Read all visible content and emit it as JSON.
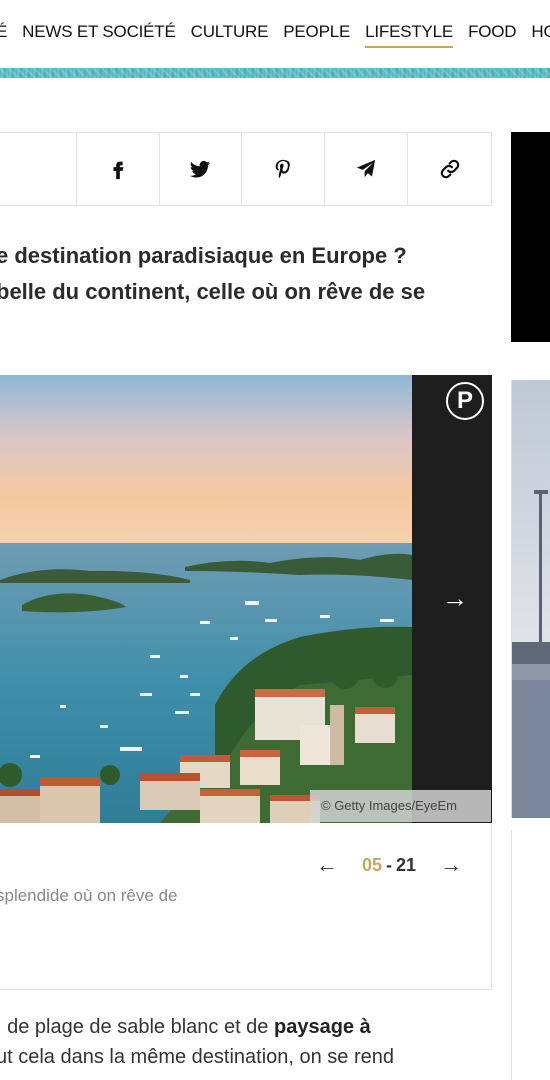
{
  "nav": {
    "items": [
      {
        "label": "É"
      },
      {
        "label": "NEWS ET SOCIÉTÉ"
      },
      {
        "label": "CULTURE"
      },
      {
        "label": "PEOPLE"
      },
      {
        "label": "LIFESTYLE"
      },
      {
        "label": "FOOD"
      },
      {
        "label": "HOMM"
      }
    ],
    "active": "LIFESTYLE"
  },
  "share": {
    "icons": [
      "facebook-icon",
      "twitter-icon",
      "pinterest-icon",
      "telegram-icon",
      "link-icon"
    ]
  },
  "intro": {
    "line1": "e destination paradisiaque en Europe ?",
    "line2": "belle du continent, celle où on rêve de se"
  },
  "slideshow": {
    "credit": "© Getty Images/EyeEm",
    "pin_label": "P",
    "next_label": "→",
    "counter_prev": "←",
    "counter_current": "05",
    "counter_sep": "-",
    "counter_total": "21",
    "counter_next": "→",
    "caption": "splendide où on rêve de"
  },
  "body": {
    "line1_a": ", de plage de sable blanc et de ",
    "line1_b": "paysage à",
    "line2": "ut cela dans la même destination, on se rend"
  },
  "colors": {
    "accent": "#c9a561",
    "rail": "#1e1e1e"
  }
}
